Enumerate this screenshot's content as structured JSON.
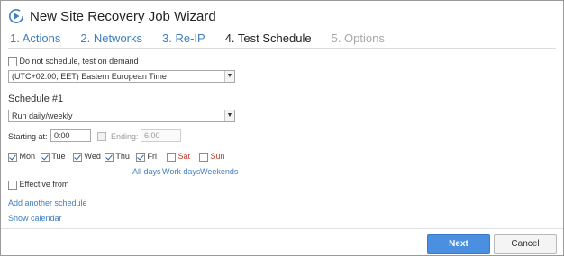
{
  "window": {
    "title": "New Site Recovery Job Wizard",
    "icon": "recovery-cycle-icon"
  },
  "steps": [
    {
      "label": "1. Actions",
      "state": "link"
    },
    {
      "label": "2. Networks",
      "state": "link"
    },
    {
      "label": "3. Re-IP",
      "state": "link"
    },
    {
      "label": "4. Test Schedule",
      "state": "active"
    },
    {
      "label": "5. Options",
      "state": "disabled"
    }
  ],
  "on_demand": {
    "label": "Do not schedule, test on demand",
    "checked": false
  },
  "timezone": {
    "value": "(UTC+02:00, EET) Eastern European Time"
  },
  "schedule": {
    "heading": "Schedule #1",
    "frequency": "Run daily/weekly",
    "starting_label": "Starting at:",
    "starting_value": "0:00",
    "ending_label": "Ending:",
    "ending_value": "6:00",
    "days": [
      {
        "label": "Mon",
        "checked": true
      },
      {
        "label": "Tue",
        "checked": true
      },
      {
        "label": "Wed",
        "checked": true
      },
      {
        "label": "Thu",
        "checked": true
      },
      {
        "label": "Fri",
        "checked": true
      },
      {
        "label": "Sat",
        "checked": false
      },
      {
        "label": "Sun",
        "checked": false
      }
    ],
    "quick_links": {
      "all": "All days",
      "work": "Work days",
      "weekends": "Weekends"
    },
    "effective_from_label": "Effective from"
  },
  "links": {
    "add_schedule": "Add another schedule",
    "show_calendar": "Show calendar"
  },
  "buttons": {
    "next": "Next",
    "cancel": "Cancel"
  },
  "colors": {
    "link": "#3f7fbf",
    "weekend": "#c0392b",
    "primary_button": "#4a8fe0"
  }
}
